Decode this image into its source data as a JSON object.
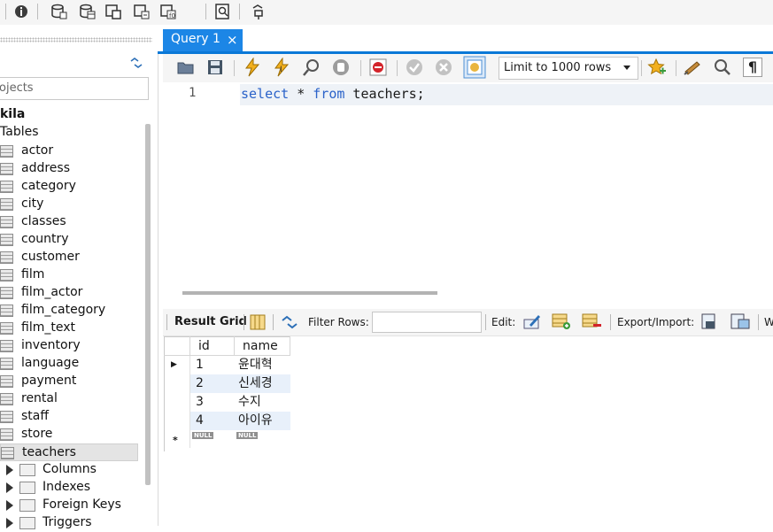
{
  "navigator": {
    "search_placeholder": "ojects",
    "schema_name": "kila",
    "tables_label": "Tables",
    "tables": [
      "actor",
      "address",
      "category",
      "city",
      "classes",
      "country",
      "customer",
      "film",
      "film_actor",
      "film_category",
      "film_text",
      "inventory",
      "language",
      "payment",
      "rental",
      "staff",
      "store",
      "teachers"
    ],
    "selected_table": "teachers",
    "subnodes": [
      "Columns",
      "Indexes",
      "Foreign Keys",
      "Triggers"
    ]
  },
  "query_tab": {
    "label": "Query 1",
    "close_glyph": "×"
  },
  "editor_toolbar": {
    "limit_label": "Limit to 1000 rows",
    "pilcrow": "¶"
  },
  "editor": {
    "line_number": "1",
    "code": {
      "kw_select": "select",
      "star": " * ",
      "kw_from": "from",
      "rest": " teachers;"
    }
  },
  "result_toolbar": {
    "result_grid_label": "Result Grid",
    "filter_label": "Filter Rows:",
    "edit_label": "Edit:",
    "export_label": "Export/Import:",
    "trailing_label": "W"
  },
  "grid": {
    "columns": [
      "id",
      "name"
    ],
    "rows": [
      {
        "id": "1",
        "name": "윤대혁"
      },
      {
        "id": "2",
        "name": "신세경"
      },
      {
        "id": "3",
        "name": "수지"
      },
      {
        "id": "4",
        "name": "아이유"
      }
    ],
    "null_label": "NULL",
    "new_row_marker": "*",
    "current_row_marker": "▶"
  },
  "colors": {
    "accent": "#1c86e6",
    "keyword": "#2a62c9",
    "row_highlight": "#e8f0fa"
  }
}
